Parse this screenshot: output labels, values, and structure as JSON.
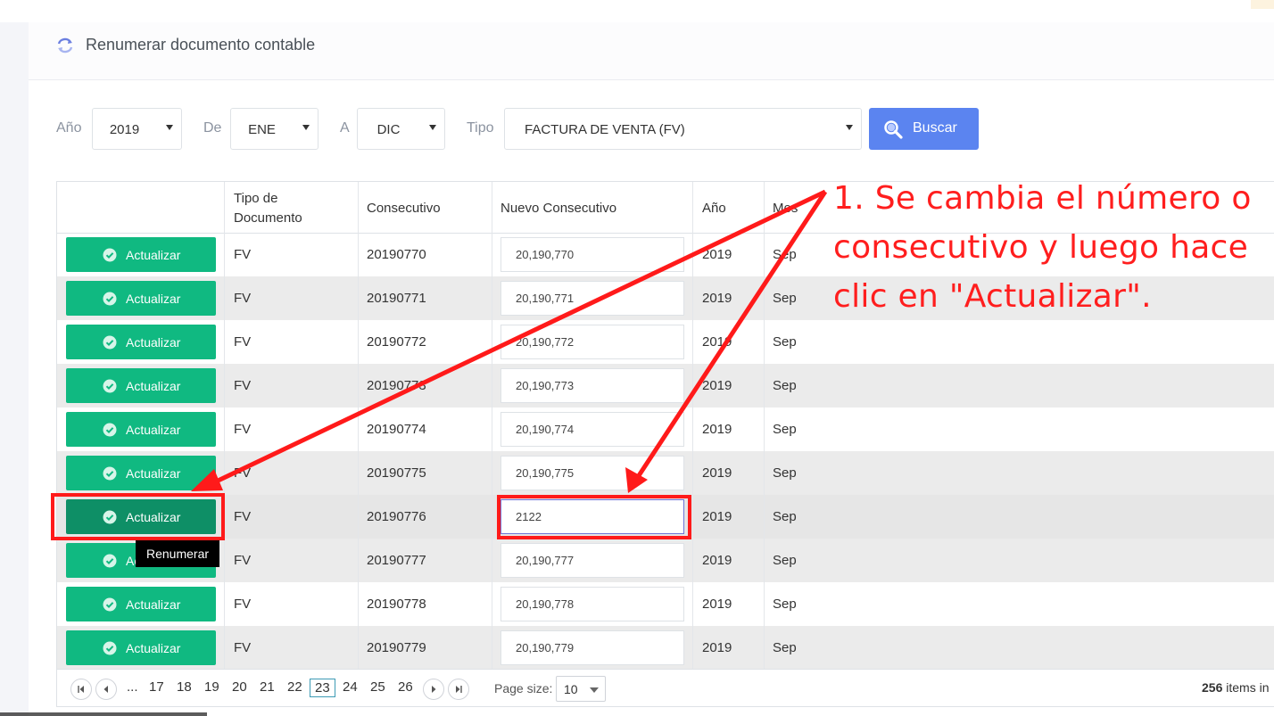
{
  "header": {
    "title": "Renumerar documento contable",
    "icon": "refresh-icon"
  },
  "filters": {
    "year_label": "Año",
    "year_value": "2019",
    "from_label": "De",
    "from_value": "ENE",
    "to_label": "A",
    "to_value": "DIC",
    "type_label": "Tipo",
    "type_value": "FACTURA DE VENTA (FV)",
    "search_label": "Buscar"
  },
  "table": {
    "headers": {
      "tipo_1": "Tipo de",
      "tipo_2": "Documento",
      "consecutivo": "Consecutivo",
      "nuevo": "Nuevo Consecutivo",
      "anio": "Año",
      "mes": "Mes"
    },
    "rows": [
      {
        "btn": "Actualizar",
        "tipo": "FV",
        "consecutivo": "20190770",
        "nuevo": "20,190,770",
        "anio": "2019",
        "mes": "Sep"
      },
      {
        "btn": "Actualizar",
        "tipo": "FV",
        "consecutivo": "20190771",
        "nuevo": "20,190,771",
        "anio": "2019",
        "mes": "Sep"
      },
      {
        "btn": "Actualizar",
        "tipo": "FV",
        "consecutivo": "20190772",
        "nuevo": "20,190,772",
        "anio": "2019",
        "mes": "Sep"
      },
      {
        "btn": "Actualizar",
        "tipo": "FV",
        "consecutivo": "20190773",
        "nuevo": "20,190,773",
        "anio": "2019",
        "mes": "Sep"
      },
      {
        "btn": "Actualizar",
        "tipo": "FV",
        "consecutivo": "20190774",
        "nuevo": "20,190,774",
        "anio": "2019",
        "mes": "Sep"
      },
      {
        "btn": "Actualizar",
        "tipo": "FV",
        "consecutivo": "20190775",
        "nuevo": "20,190,775",
        "anio": "2019",
        "mes": "Sep"
      },
      {
        "btn": "Actualizar",
        "tipo": "FV",
        "consecutivo": "20190776",
        "nuevo": "2122",
        "anio": "2019",
        "mes": "Sep"
      },
      {
        "btn": "Actualizar",
        "tipo": "FV",
        "consecutivo": "20190777",
        "nuevo": "20,190,777",
        "anio": "2019",
        "mes": "Sep"
      },
      {
        "btn": "Actualizar",
        "tipo": "FV",
        "consecutivo": "20190778",
        "nuevo": "20,190,778",
        "anio": "2019",
        "mes": "Sep"
      },
      {
        "btn": "Actualizar",
        "tipo": "FV",
        "consecutivo": "20190779",
        "nuevo": "20,190,779",
        "anio": "2019",
        "mes": "Sep"
      }
    ]
  },
  "pager": {
    "ellipsis": "...",
    "pages": [
      "17",
      "18",
      "19",
      "20",
      "21",
      "22",
      "23",
      "24",
      "25",
      "26"
    ],
    "current": "23",
    "page_size_label": "Page size:",
    "page_size": "10",
    "total_count": "256",
    "total_suffix": "items in"
  },
  "tooltip": "Renumerar",
  "annotation": {
    "line1": "1. Se cambia el número o",
    "line2": "consecutivo y luego hace",
    "line3": "clic en \"Actualizar\"."
  },
  "colors": {
    "accent": "#5b84f0",
    "success": "#10b981",
    "annotation": "#ff1e1e"
  }
}
